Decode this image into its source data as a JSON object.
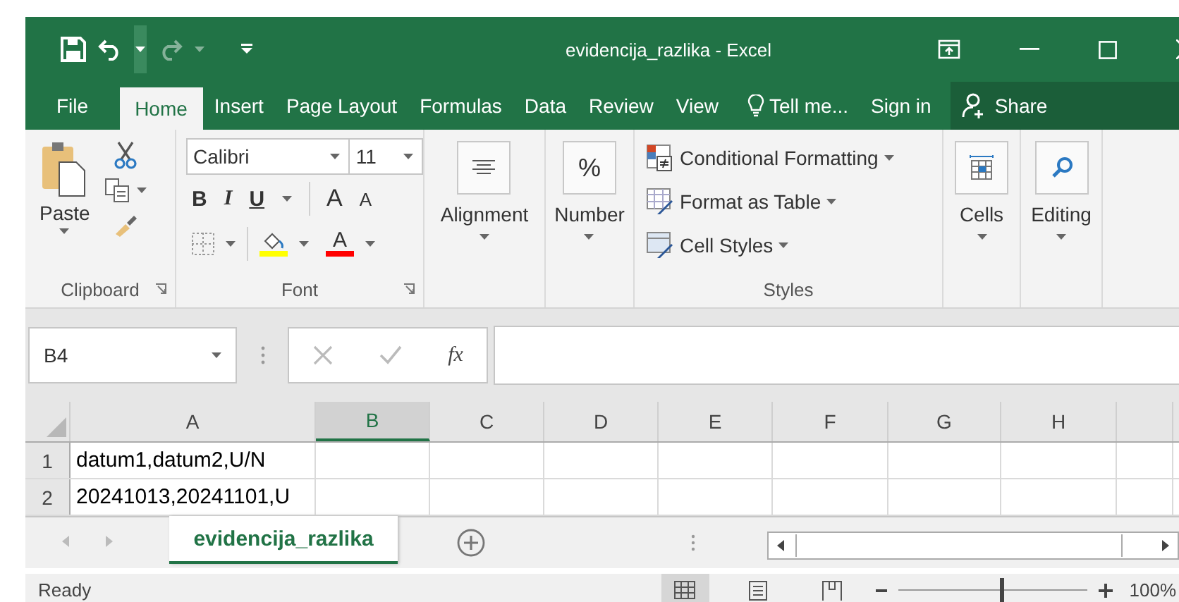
{
  "window": {
    "title": "evidencija_razlika - Excel"
  },
  "quick_access": {
    "undo_enabled": true,
    "redo_enabled": false
  },
  "ribbon_tabs": [
    {
      "label": "File",
      "selected": false
    },
    {
      "label": "Home",
      "selected": true
    },
    {
      "label": "Insert",
      "selected": false
    },
    {
      "label": "Page Layout",
      "selected": false
    },
    {
      "label": "Formulas",
      "selected": false
    },
    {
      "label": "Data",
      "selected": false
    },
    {
      "label": "Review",
      "selected": false
    },
    {
      "label": "View",
      "selected": false
    }
  ],
  "tell_me": "Tell me...",
  "sign_in": "Sign in",
  "share": "Share",
  "clipboard": {
    "paste": "Paste",
    "group": "Clipboard"
  },
  "font": {
    "name": "Calibri",
    "size": "11",
    "bold": "B",
    "italic": "I",
    "underline": "U",
    "grow": "A",
    "shrink": "A",
    "font_color": "A",
    "group": "Font"
  },
  "alignment": {
    "label": "Alignment"
  },
  "number": {
    "symbol": "%",
    "label": "Number"
  },
  "styles": {
    "items": [
      "Conditional Formatting",
      "Format as Table",
      "Cell Styles"
    ],
    "group": "Styles"
  },
  "cells": {
    "label": "Cells"
  },
  "editing": {
    "label": "Editing"
  },
  "formula_bar": {
    "name_box": "B4",
    "function_symbol": "fx"
  },
  "grid": {
    "columns": [
      {
        "label": "A",
        "selected": false
      },
      {
        "label": "B",
        "selected": true
      },
      {
        "label": "C",
        "selected": false
      },
      {
        "label": "D",
        "selected": false
      },
      {
        "label": "E",
        "selected": false
      },
      {
        "label": "F",
        "selected": false
      },
      {
        "label": "G",
        "selected": false
      },
      {
        "label": "H",
        "selected": false
      }
    ],
    "rows": [
      {
        "number": "1",
        "value": "datum1,datum2,U/N"
      },
      {
        "number": "2",
        "value": "20241013,20241101,U"
      }
    ]
  },
  "sheets": [
    {
      "label": "evidencija_razlika",
      "selected": true
    }
  ],
  "status_bar": {
    "text": "Ready",
    "views": [
      {
        "kind": "normal",
        "selected": true
      },
      {
        "kind": "page-layout",
        "selected": false
      },
      {
        "kind": "page-break",
        "selected": false
      }
    ],
    "zoom": {
      "level": 0.55
    },
    "zoom_text": "100%"
  }
}
